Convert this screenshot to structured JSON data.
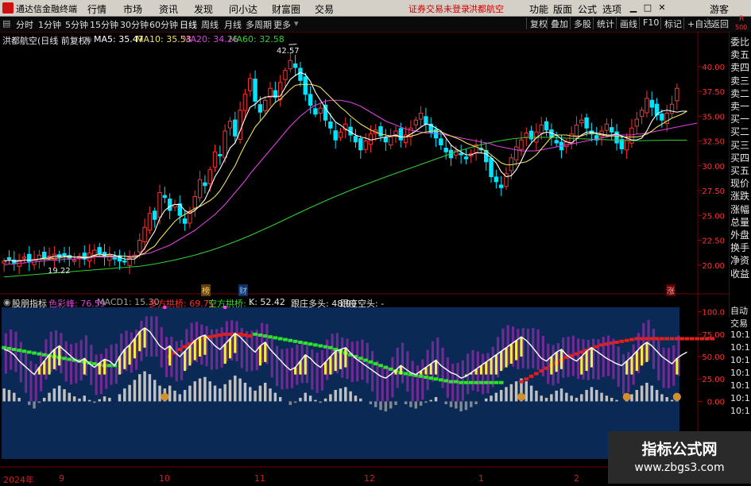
{
  "app": {
    "title": "通达信金融终端",
    "warning": "证券交易未登录",
    "stock_tag": "洪都航空"
  },
  "menu": [
    "行情",
    "市场",
    "资讯",
    "发现",
    "问小达",
    "财富圈",
    "交易"
  ],
  "right_menu": [
    "功能",
    "版面",
    "公式",
    "选项"
  ],
  "guest": "游客",
  "periods": [
    "分时",
    "1分钟",
    "5分钟",
    "15分钟",
    "30分钟",
    "60分钟",
    "日线",
    "周线",
    "月线",
    "多周期",
    "更多"
  ],
  "selected_period": "日线",
  "toolbar": [
    "复权",
    "叠加",
    "多股",
    "统计",
    "画线",
    "F10",
    "标记",
    "+自选",
    "返回"
  ],
  "chart_header": {
    "stock": "洪都航空(日线 前复权)",
    "ma5": "MA5: 35.47",
    "ma10": "MA10: 35.53",
    "ma20": "MA20: 34.26",
    "ma60": "MA60: 32.58"
  },
  "annotations": {
    "high": "42.57",
    "low": "19.22",
    "badge1": "榜",
    "badge2": "财",
    "badge3": "涨"
  },
  "colors": {
    "up": "#ff3232",
    "down": "#00e5ff",
    "ma5": "#ffffff",
    "ma10": "#f0e060",
    "ma20": "#e040e0",
    "ma60": "#30d030"
  },
  "right_labels": [
    "委比",
    "卖五",
    "卖四",
    "卖三",
    "卖二",
    "卖一",
    "买一",
    "买二",
    "买三",
    "买四",
    "买五",
    "现价",
    "涨跌",
    "涨幅",
    "总量",
    "外盘",
    "换手",
    "净资",
    "收益"
  ],
  "right_labels2": [
    "自动",
    "交易",
    "10:1",
    "10:1",
    "10:1",
    "10:1",
    "10:1",
    "10:1",
    "10:1"
  ],
  "corner": {
    "r": "R",
    "n": "500"
  },
  "indicator": {
    "name": "股朋指标",
    "items": [
      {
        "label": "色彩峰: 76.59",
        "color": "#e040e0"
      },
      {
        "label": "MACD1: 15.30",
        "color": "#a0a0a0"
      },
      {
        "label": "多方拱桥: 69.71",
        "color": "#ff3030"
      },
      {
        "label": "空方拱桥: -",
        "color": "#30e030"
      },
      {
        "label": "K: 52.42",
        "color": "#e8e8e8"
      },
      {
        "label": "跟庄多头: 48.90",
        "color": "#e8e8e8"
      },
      {
        "label": "跟庄空头: -",
        "color": "#e8e8e8"
      }
    ]
  },
  "x_labels": [
    "2024年",
    "9",
    "10",
    "11",
    "12",
    "1",
    "2"
  ],
  "watermark": {
    "title": "指标公式网",
    "url": "www.zbgs3.com"
  },
  "chart_data": {
    "type": "candlestick",
    "price_axis": [
      "40.00",
      "37.50",
      "35.00",
      "32.50",
      "30.00",
      "27.50",
      "25.00",
      "22.50",
      "20.00"
    ],
    "indicator_axis": [
      "100.0",
      "75.00",
      "50.00",
      "25.00",
      "0.00"
    ],
    "ylim": [
      17.5,
      43.5
    ],
    "indicator_ylim": [
      -20,
      105
    ],
    "closes": [
      20.4,
      20.6,
      20.2,
      20.5,
      20.8,
      20.3,
      20.6,
      21.0,
      20.7,
      20.9,
      21.1,
      20.8,
      21.0,
      20.7,
      20.5,
      20.9,
      20.6,
      21.2,
      21.5,
      21.1,
      20.8,
      21.0,
      20.6,
      20.4,
      20.3,
      20.7,
      21.0,
      22.5,
      23.8,
      25.2,
      24.6,
      27.3,
      26.8,
      25.5,
      26.1,
      25.0,
      24.2,
      25.4,
      26.9,
      28.6,
      28.0,
      29.6,
      31.4,
      31.0,
      33.5,
      34.5,
      33.0,
      35.6,
      37.2,
      38.8,
      36.5,
      35.4,
      36.6,
      37.8,
      36.9,
      38.4,
      39.6,
      40.6,
      39.9,
      38.6,
      37.2,
      36.1,
      35.2,
      35.8,
      34.6,
      33.8,
      32.6,
      33.4,
      34.2,
      33.1,
      32.4,
      31.6,
      32.5,
      33.2,
      33.6,
      33.0,
      32.4,
      32.9,
      33.5,
      32.6,
      33.1,
      33.8,
      34.6,
      35.3,
      34.2,
      33.3,
      32.8,
      32.1,
      31.4,
      30.8,
      31.5,
      31.1,
      30.7,
      31.2,
      32.1,
      31.6,
      30.4,
      28.9,
      28.4,
      27.8,
      29.2,
      30.8,
      31.9,
      32.6,
      33.3,
      32.7,
      33.4,
      34.1,
      33.6,
      32.9,
      32.3,
      31.6,
      32.4,
      33.2,
      34.1,
      34.6,
      33.8,
      33.2,
      32.6,
      33.5,
      34.2,
      33.4,
      32.3,
      31.7,
      32.6,
      33.8,
      34.7,
      35.6,
      36.8,
      35.9,
      35.1,
      34.6,
      35.3,
      36.2,
      37.8
    ],
    "ma5": [
      20.4,
      20.5,
      20.4,
      20.4,
      20.5,
      20.5,
      20.5,
      20.6,
      20.7,
      20.7,
      20.9,
      20.9,
      20.9,
      20.9,
      20.8,
      20.8,
      20.7,
      20.8,
      21.0,
      21.1,
      21.0,
      21.1,
      21.0,
      20.8,
      20.6,
      20.6,
      20.6,
      21.0,
      21.7,
      22.6,
      23.4,
      24.7,
      25.5,
      25.9,
      26.1,
      26.1,
      25.5,
      25.2,
      25.5,
      26.0,
      26.6,
      27.7,
      28.9,
      29.7,
      30.7,
      31.8,
      32.3,
      33.5,
      34.8,
      35.9,
      36.2,
      36.7,
      36.9,
      37.0,
      37.0,
      37.0,
      37.9,
      38.7,
      39.1,
      39.4,
      39.2,
      38.5,
      37.4,
      36.6,
      35.8,
      35.1,
      34.4,
      34.1,
      33.7,
      33.4,
      33.1,
      32.9,
      32.8,
      32.6,
      32.7,
      32.8,
      32.9,
      33.0,
      33.1,
      32.9,
      32.9,
      33.2,
      33.5,
      33.9,
      34.2,
      34.1,
      33.8,
      33.5,
      32.8,
      32.1,
      31.7,
      31.4,
      31.1,
      31.1,
      31.3,
      31.3,
      31.2,
      30.8,
      30.3,
      29.4,
      28.9,
      29.0,
      29.6,
      30.5,
      31.6,
      32.3,
      32.8,
      33.2,
      33.4,
      33.3,
      33.1,
      32.7,
      32.4,
      32.3,
      32.7,
      33.1,
      33.4,
      33.4,
      33.3,
      33.2,
      33.1,
      33.1,
      33.2,
      33.0,
      32.8,
      32.6,
      32.6,
      32.8,
      33.5,
      34.5,
      35.2,
      35.5,
      35.6,
      35.5,
      35.4,
      35.5,
      35.5
    ],
    "ma10": [
      20.4,
      20.5,
      20.4,
      20.4,
      20.5,
      20.5,
      20.5,
      20.6,
      20.6,
      20.6,
      20.7,
      20.7,
      20.8,
      20.8,
      20.8,
      20.8,
      20.8,
      20.8,
      20.9,
      20.9,
      20.9,
      20.9,
      20.9,
      20.9,
      20.9,
      20.8,
      20.8,
      21.0,
      21.2,
      21.6,
      21.9,
      22.6,
      23.2,
      23.8,
      24.4,
      24.8,
      25.1,
      25.4,
      25.7,
      25.9,
      26.2,
      26.5,
      26.9,
      27.5,
      28.3,
      29.2,
      30.0,
      31.1,
      32.1,
      33.0,
      33.9,
      34.5,
      35.1,
      35.8,
      36.4,
      36.7,
      37.2,
      37.7,
      38.1,
      38.2,
      38.2,
      38.2,
      38.1,
      37.9,
      37.4,
      36.9,
      36.4,
      35.9,
      35.5,
      35.0,
      34.6,
      34.2,
      33.9,
      33.6,
      33.4,
      33.2,
      33.1,
      33.0,
      33.0,
      32.9,
      32.9,
      33.0,
      33.1,
      33.3,
      33.4,
      33.5,
      33.5,
      33.4,
      33.2,
      33.0,
      32.8,
      32.6,
      32.3,
      32.1,
      31.9,
      31.7,
      31.5,
      31.1,
      30.7,
      30.3,
      30.1,
      30.1,
      30.2,
      30.3,
      30.4,
      30.7,
      31.1,
      31.7,
      32.3,
      32.9,
      33.1,
      33.1,
      33.1,
      33.0,
      33.0,
      33.0,
      33.2,
      33.3,
      33.2,
      33.1,
      33.0,
      33.0,
      33.0,
      32.9,
      32.9,
      32.9,
      32.9,
      33.0,
      33.2,
      33.5,
      33.9,
      34.2,
      34.5,
      34.8,
      35.0,
      35.2,
      35.5
    ],
    "ma20": [
      20.0,
      20.1,
      20.1,
      20.2,
      20.2,
      20.3,
      20.3,
      20.4,
      20.4,
      20.5,
      20.5,
      20.5,
      20.6,
      20.6,
      20.6,
      20.7,
      20.7,
      20.7,
      20.8,
      20.8,
      20.8,
      20.8,
      20.8,
      20.9,
      20.9,
      20.9,
      20.9,
      21.0,
      21.1,
      21.2,
      21.4,
      21.6,
      21.8,
      22.0,
      22.3,
      22.6,
      22.9,
      23.2,
      23.5,
      23.9,
      24.3,
      24.7,
      25.1,
      25.6,
      26.1,
      26.7,
      27.3,
      27.9,
      28.5,
      29.2,
      29.8,
      30.4,
      31.0,
      31.6,
      32.2,
      32.8,
      33.4,
      34.0,
      34.5,
      35.0,
      35.4,
      35.8,
      36.1,
      36.3,
      36.5,
      36.6,
      36.6,
      36.6,
      36.5,
      36.4,
      36.2,
      36.0,
      35.7,
      35.4,
      35.1,
      34.8,
      34.5,
      34.3,
      34.1,
      33.9,
      33.7,
      33.6,
      33.5,
      33.4,
      33.3,
      33.3,
      33.2,
      33.2,
      33.1,
      33.0,
      32.9,
      32.8,
      32.7,
      32.6,
      32.5,
      32.4,
      32.3,
      32.2,
      32.0,
      31.9,
      31.8,
      31.7,
      31.6,
      31.5,
      31.5,
      31.5,
      31.5,
      31.6,
      31.7,
      31.8,
      31.9,
      32.0,
      32.1,
      32.2,
      32.3,
      32.4,
      32.5,
      32.6,
      32.7,
      32.8,
      32.9,
      33.0,
      33.1,
      33.1,
      33.1,
      33.1,
      33.2,
      33.2,
      33.3,
      33.4,
      33.5,
      33.6,
      33.7,
      33.8,
      33.9,
      34.0,
      34.1,
      34.2,
      34.3
    ],
    "ma60": [
      18.8,
      18.84,
      18.88,
      18.92,
      18.96,
      19.0,
      19.04,
      19.08,
      19.12,
      19.16,
      19.2,
      19.24,
      19.28,
      19.32,
      19.36,
      19.4,
      19.44,
      19.48,
      19.52,
      19.56,
      19.6,
      19.64,
      19.68,
      19.72,
      19.76,
      19.8,
      19.84,
      19.88,
      19.95,
      20.03,
      20.11,
      20.21,
      20.31,
      20.41,
      20.51,
      20.63,
      20.75,
      20.87,
      21.0,
      21.15,
      21.3,
      21.45,
      21.62,
      21.79,
      21.98,
      22.17,
      22.36,
      22.56,
      22.77,
      22.98,
      23.2,
      23.43,
      23.66,
      23.89,
      24.12,
      24.36,
      24.6,
      24.84,
      25.08,
      25.32,
      25.56,
      25.79,
      26.02,
      26.25,
      26.47,
      26.69,
      26.91,
      27.12,
      27.33,
      27.53,
      27.73,
      27.93,
      28.12,
      28.31,
      28.5,
      28.69,
      28.88,
      29.06,
      29.24,
      29.42,
      29.6,
      29.78,
      29.96,
      30.14,
      30.32,
      30.5,
      30.68,
      30.86,
      31.04,
      31.22,
      31.4,
      31.55,
      31.7,
      31.85,
      32.0,
      32.13,
      32.25,
      32.35,
      32.45,
      32.54,
      32.62,
      32.7,
      32.76,
      32.8,
      32.84,
      32.86,
      32.87,
      32.87,
      32.86,
      32.84,
      32.82,
      32.8,
      32.78,
      32.76,
      32.74,
      32.72,
      32.7,
      32.68,
      32.66,
      32.64,
      32.62,
      32.6,
      32.58,
      32.56,
      32.55,
      32.54,
      32.53,
      32.53,
      32.54,
      32.55,
      32.56,
      32.57,
      32.58,
      32.58,
      32.58,
      32.58,
      32.58
    ],
    "k": [
      58,
      56,
      52,
      45,
      40,
      35,
      30,
      38,
      45,
      52,
      58,
      62,
      57,
      52,
      47,
      44,
      48,
      42,
      38,
      43,
      47,
      45,
      40,
      50,
      58,
      63,
      70,
      78,
      82,
      78,
      70,
      62,
      58,
      62,
      55,
      50,
      56,
      62,
      68,
      72,
      74,
      68,
      62,
      58,
      64,
      70,
      76,
      72,
      66,
      60,
      55,
      62,
      66,
      58,
      52,
      46,
      40,
      35,
      38,
      45,
      52,
      48,
      42,
      38,
      44,
      50,
      56,
      58,
      60,
      54,
      48,
      44,
      40,
      36,
      32,
      28,
      26,
      30,
      35,
      40,
      36,
      32,
      30,
      34,
      38,
      42,
      46,
      40,
      36,
      32,
      30,
      26,
      28,
      32,
      36,
      40,
      44,
      48,
      52,
      56,
      60,
      64,
      68,
      72,
      68,
      62,
      55,
      48,
      45,
      50,
      55,
      58,
      52,
      48,
      45,
      50,
      56,
      60,
      56,
      52,
      48,
      45,
      42,
      40,
      45,
      50,
      56,
      62,
      66,
      62,
      56,
      50,
      46,
      42,
      48,
      52,
      55
    ],
    "bridge_bull": [
      null,
      null,
      null,
      null,
      null,
      null,
      null,
      null,
      null,
      null,
      null,
      null,
      null,
      null,
      null,
      null,
      null,
      null,
      null,
      null,
      null,
      null,
      null,
      null,
      null,
      null,
      null,
      null,
      null,
      null,
      null,
      null,
      null,
      50,
      54,
      58,
      61,
      64,
      67,
      69,
      71,
      72,
      73,
      74,
      75,
      75,
      75,
      75,
      74,
      73,
      null,
      null,
      null,
      null,
      null,
      null,
      null,
      null,
      null,
      null,
      null,
      null,
      null,
      null,
      null,
      null,
      null,
      null,
      null,
      null,
      null,
      null,
      null,
      null,
      null,
      null,
      null,
      null,
      null,
      null,
      null,
      null,
      null,
      null,
      null,
      null,
      null,
      null,
      null,
      null,
      null,
      null,
      null,
      null,
      null,
      null,
      null,
      null,
      null,
      null,
      null,
      null,
      null,
      22,
      25,
      28,
      31,
      34,
      37,
      40,
      43,
      46,
      49,
      51,
      53,
      55,
      57,
      59,
      61,
      63,
      64,
      65,
      66,
      67,
      68,
      69,
      70,
      70,
      70,
      70,
      70,
      70,
      70,
      70,
      70,
      70,
      70,
      70,
      70,
      70,
      70,
      70
    ],
    "bridge_bear": [
      60,
      59,
      58,
      57,
      56,
      55,
      54,
      53,
      52,
      51,
      50,
      49,
      48,
      47,
      46,
      45,
      44,
      43,
      42,
      41,
      40,
      40,
      40,
      null,
      null,
      null,
      null,
      null,
      null,
      null,
      null,
      null,
      null,
      null,
      null,
      null,
      null,
      null,
      null,
      null,
      null,
      null,
      null,
      null,
      null,
      null,
      null,
      null,
      null,
      null,
      75,
      74,
      73,
      72,
      71,
      70,
      69,
      68,
      67,
      66,
      65,
      64,
      63,
      62,
      61,
      60,
      58,
      56,
      54,
      52,
      50,
      48,
      46,
      44,
      42,
      40,
      38,
      36,
      34,
      32,
      31,
      30,
      29,
      28,
      27,
      26,
      25,
      24,
      23,
      22,
      22,
      21,
      21,
      21,
      21,
      21,
      21,
      21,
      21,
      21,
      null,
      null,
      null,
      null,
      null,
      null,
      null,
      null,
      null,
      null,
      null,
      null,
      null,
      null,
      null,
      null,
      null,
      null,
      null,
      null,
      null,
      null,
      null,
      null,
      null,
      null,
      null,
      null,
      null,
      null,
      null,
      null,
      null,
      null,
      null,
      null,
      null,
      null,
      null,
      null,
      null,
      null,
      null,
      null
    ]
  }
}
